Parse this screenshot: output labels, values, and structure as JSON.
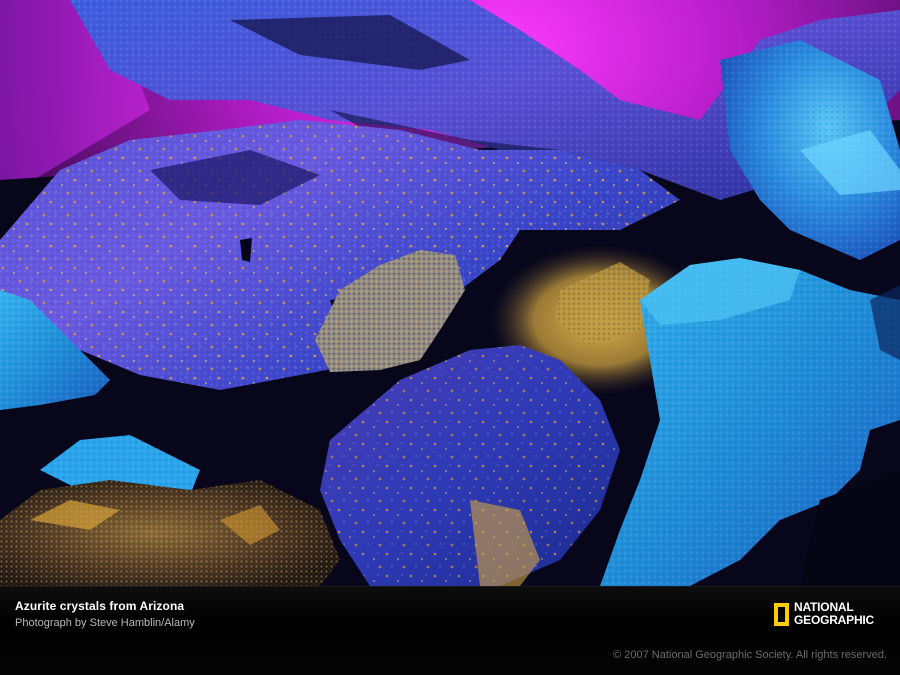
{
  "photo": {
    "subject": "blue azurite crystal clusters with orange-gold specks against a magenta backdrop"
  },
  "caption": {
    "title": "Azurite crystals from Arizona",
    "credit": "Photograph by Steve Hamblin/Alamy"
  },
  "logo": {
    "line1": "NATIONAL",
    "line2": "GEOGRAPHIC",
    "frame_color": "#ffcc00"
  },
  "copyright": "© 2007 National Geographic Society. All rights reserved.",
  "colors": {
    "background_magenta": "#d21fd8",
    "crystal_blue": "#2b56d6",
    "crystal_cyan": "#1fa9e6",
    "speck_orange": "#e3a53a",
    "caption_bg": "#000000"
  }
}
